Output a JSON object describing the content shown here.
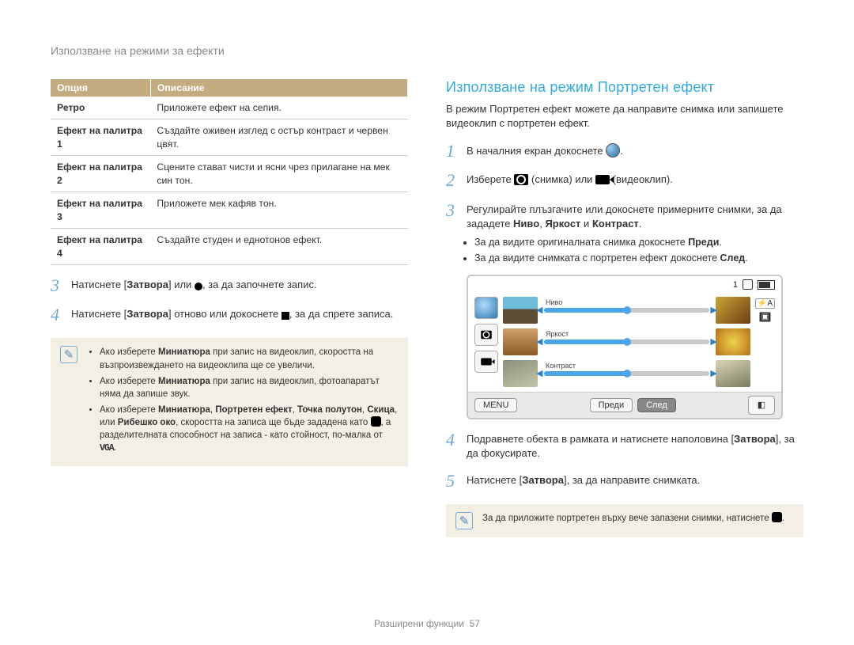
{
  "header": "Използване на режими за ефекти",
  "table": {
    "head": {
      "c1": "Опция",
      "c2": "Описание"
    },
    "rows": [
      {
        "opt": "Ретро",
        "desc": "Приложете ефект на сепия."
      },
      {
        "opt": "Ефект на палитра 1",
        "desc": "Създайте оживен изглед с остър контраст и червен цвят."
      },
      {
        "opt": "Ефект на палитра 2",
        "desc": "Сцените стават чисти и ясни чрез прилагане на мек син тон."
      },
      {
        "opt": "Ефект на палитра 3",
        "desc": "Приложете мек кафяв тон."
      },
      {
        "opt": "Ефект на палитра 4",
        "desc": "Създайте студен и еднотонов ефект."
      }
    ]
  },
  "left_steps": {
    "s3_a": "Натиснете [",
    "s3_b": "Затвора",
    "s3_c": "] или ",
    "s3_d": ", за да започнете запис.",
    "s4_a": "Натиснете [",
    "s4_b": "Затвора",
    "s4_c": "] отново или докоснете ",
    "s4_d": ", за да спрете записа."
  },
  "note_left": {
    "li1_a": "Ако изберете ",
    "li1_b": "Миниатюра",
    "li1_c": " при запис на видеоклип, скоростта на възпроизвеждането на видеоклипа ще се увеличи.",
    "li2_a": "Ако изберете ",
    "li2_b": "Миниатюра",
    "li2_c": " при запис на видеоклип, фотоапаратът няма да запише звук.",
    "li3_a": "Ако изберете ",
    "li3_b": "Миниатюра",
    "li3_c": ", ",
    "li3_d": "Портретен ефект",
    "li3_e": ", ",
    "li3_f": "Точка полутон",
    "li3_g": ", ",
    "li3_h": "Скица",
    "li3_i": ", или ",
    "li3_j": "Рибешко око",
    "li3_k": ", скоростта на записа ще бъде зададена като ",
    "li3_l": ", а разделителната способност на записа - като стойност, по-малка от ",
    "li3_vga": "VGA",
    "li3_m": "."
  },
  "right": {
    "h2": "Използване на режим Портретен ефект",
    "intro": "В режим Портретен ефект можете да направите снимка или запишете видеоклип с портретен ефект.",
    "s1_a": "В началния екран докоснете ",
    "s1_b": ".",
    "s2_a": "Изберете ",
    "s2_b": " (снимка) или ",
    "s2_c": " (видеоклип).",
    "s3_a": "Регулирайте плъзгачите или докоснете примерните снимки, за да зададете ",
    "s3_b": "Ниво",
    "s3_c": ", ",
    "s3_d": "Яркост",
    "s3_e": " и ",
    "s3_f": "Контраст",
    "s3_g": ".",
    "bul1_a": "За да видите оригиналната снимка докоснете ",
    "bul1_b": "Преди",
    "bul1_c": ".",
    "bul2_a": "За да видите снимката с портретен ефект докоснете ",
    "bul2_b": "След",
    "bul2_c": ".",
    "s4_a": "Подравнете обекта в рамката и натиснете наполовина [",
    "s4_b": "Затвора",
    "s4_c": "], за да фокусирате.",
    "s5_a": "Натиснете [",
    "s5_b": "Затвора",
    "s5_c": "], за да направите снимката."
  },
  "lcd": {
    "count": "1",
    "menu": "MENU",
    "before": "Преди",
    "after": "След",
    "sliders": {
      "level": "Ниво",
      "bright": "Яркост",
      "contrast": "Контраст"
    }
  },
  "note_right": "За да приложите портретен върху вече запазени снимки, натиснете ",
  "footer_a": "Разширени функции",
  "footer_b": "57"
}
